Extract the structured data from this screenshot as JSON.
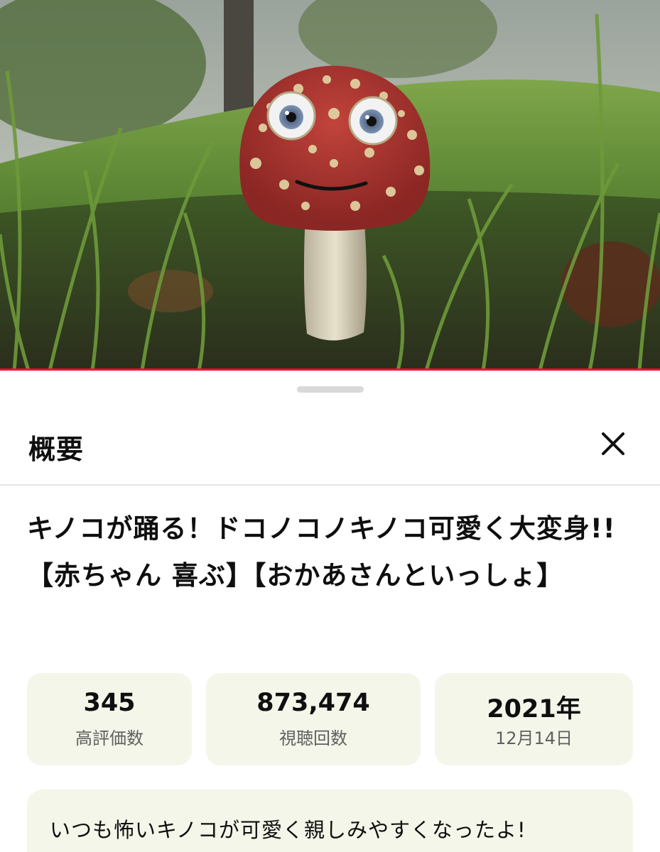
{
  "video": {
    "progress_percent": 100,
    "progress_color": "#ff0033"
  },
  "sheet": {
    "title": "概要",
    "close_icon": "close-icon"
  },
  "video_info": {
    "title": "キノコが踊る！ドコノコノキノコ可愛く大変身!!【赤ちゃん 喜ぶ】【おかあさんといっしょ】"
  },
  "stats": {
    "likes": {
      "value": "345",
      "label": "高評価数"
    },
    "views": {
      "value": "873,474",
      "label": "視聴回数"
    },
    "date": {
      "value": "2021年",
      "label": "12月14日"
    }
  },
  "description": {
    "text": "いつも怖いキノコが可愛く親しみやすくなったよ!"
  },
  "colors": {
    "accent": "#ff0033",
    "card_bg": "#f3f6e9",
    "text_primary": "#0f0f0f",
    "text_secondary": "#606060"
  }
}
